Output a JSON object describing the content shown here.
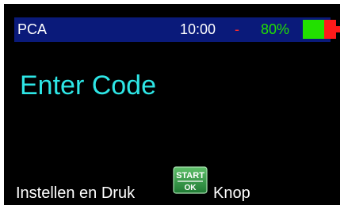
{
  "status_bar": {
    "device": "PCA",
    "time": "10:00",
    "dash": "-",
    "battery_percent": "80%",
    "battery_level": 0.8,
    "colors": {
      "bar_background": "#0a1a7a",
      "battery_green": "#22e000",
      "battery_red": "#ff1a1a",
      "dash_red": "#ff2a2a"
    }
  },
  "screen": {
    "title": "Enter Code",
    "title_color": "#2ee6e6",
    "instruction_before": "Instellen en Druk",
    "instruction_after": "Knop",
    "button_icon": {
      "name": "start-ok-icon",
      "line1": "START",
      "line2": "OK"
    }
  }
}
